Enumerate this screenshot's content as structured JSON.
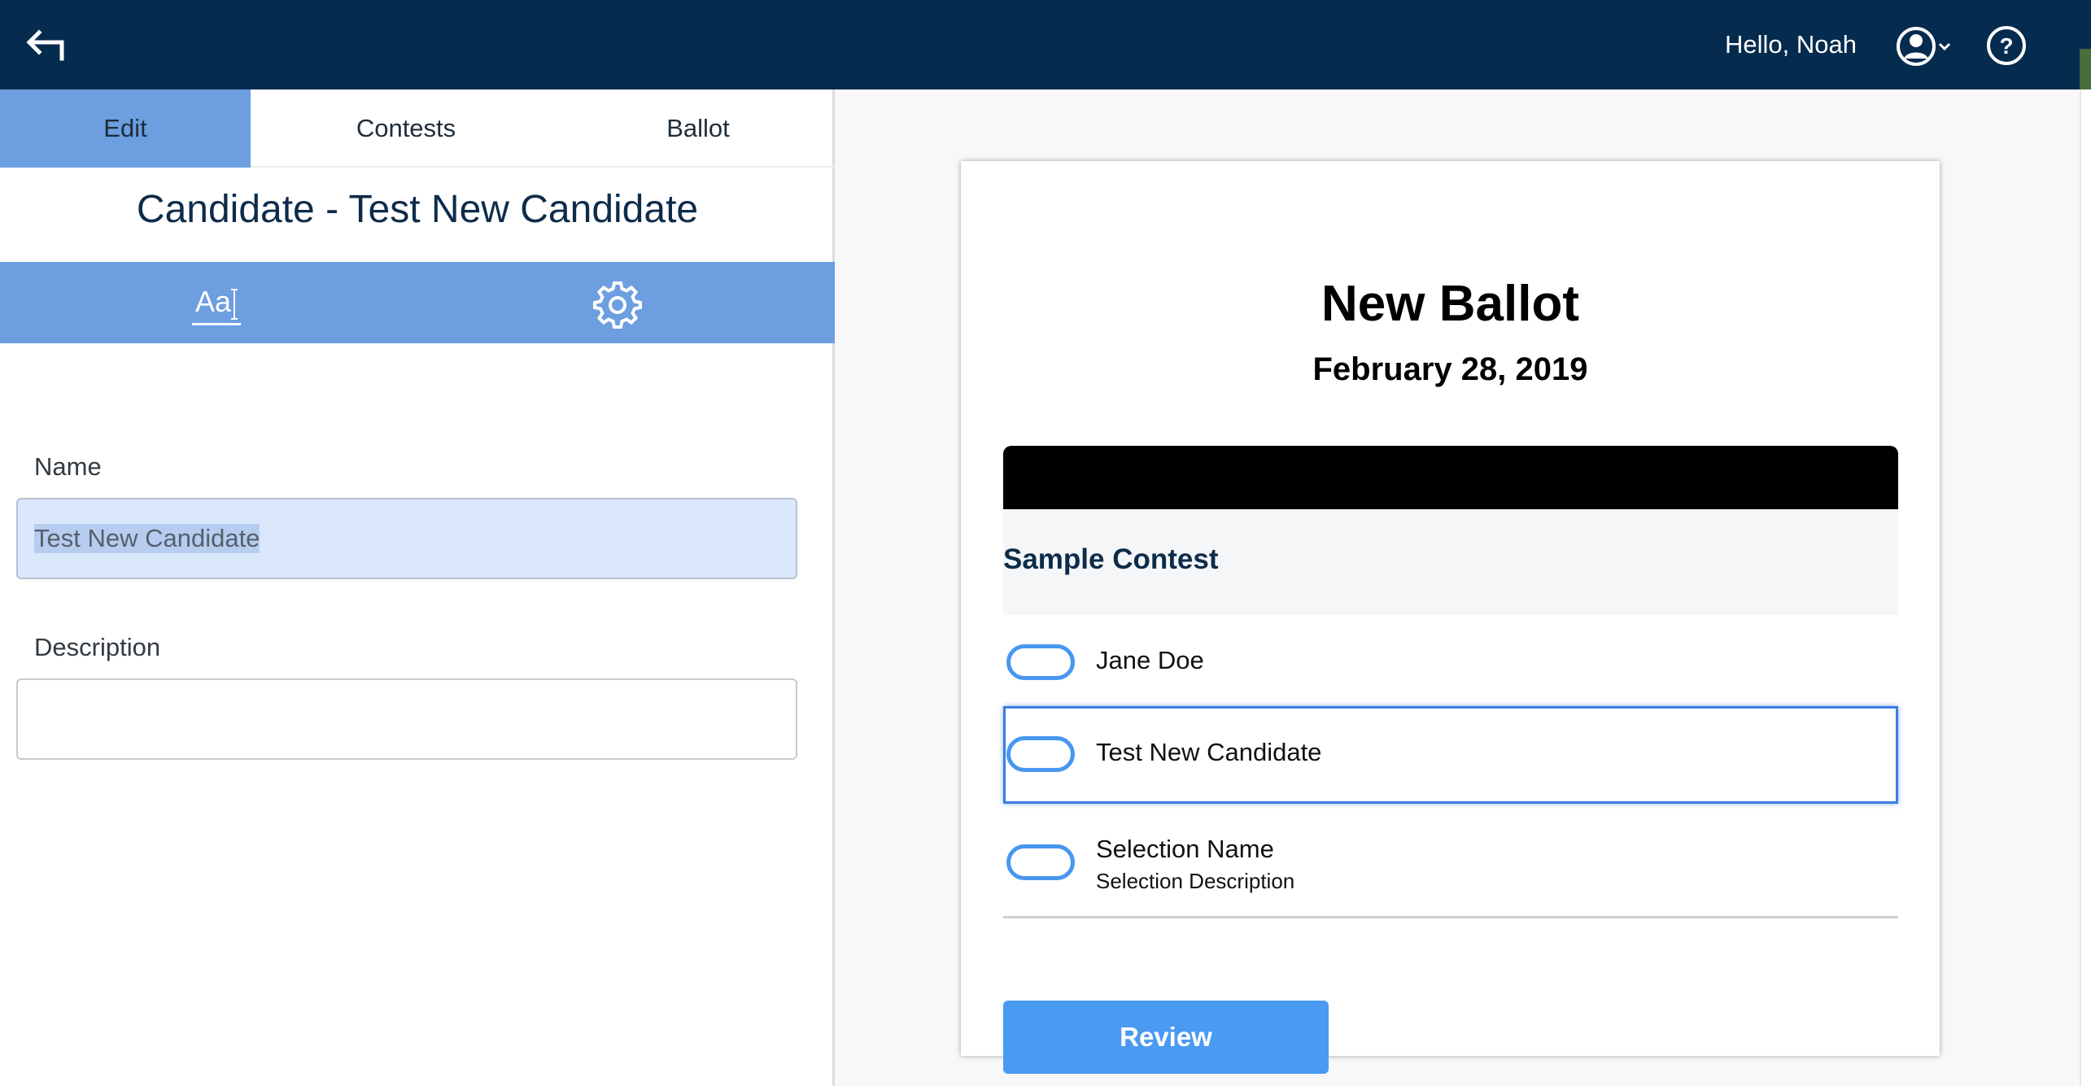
{
  "header": {
    "greeting": "Hello, Noah",
    "back_icon": "back-arrow-icon",
    "user_icon": "user-circle-icon",
    "help_icon": "help-circle-icon",
    "bg_color": "#052b4e"
  },
  "editor": {
    "tabs": [
      {
        "label": "Edit",
        "active": true
      },
      {
        "label": "Contests",
        "active": false
      },
      {
        "label": "Ballot",
        "active": false
      }
    ],
    "title": "Candidate - Test New Candidate",
    "toolbar": {
      "typography_label": "Aa",
      "settings_icon": "gear-icon"
    },
    "fields": {
      "name_label": "Name",
      "name_value": "Test New Candidate",
      "description_label": "Description",
      "description_value": ""
    },
    "accent_color": "#6c9ee0"
  },
  "ballot": {
    "title": "New Ballot",
    "date": "February 28, 2019",
    "contest": {
      "name": "Sample Contest",
      "options": [
        {
          "name": "Jane Doe",
          "description": "",
          "highlighted": false
        },
        {
          "name": "Test New Candidate",
          "description": "",
          "highlighted": true
        },
        {
          "name": "Selection Name",
          "description": "Selection Description",
          "highlighted": false
        }
      ]
    },
    "review_label": "Review",
    "button_color": "#4a9af2"
  }
}
